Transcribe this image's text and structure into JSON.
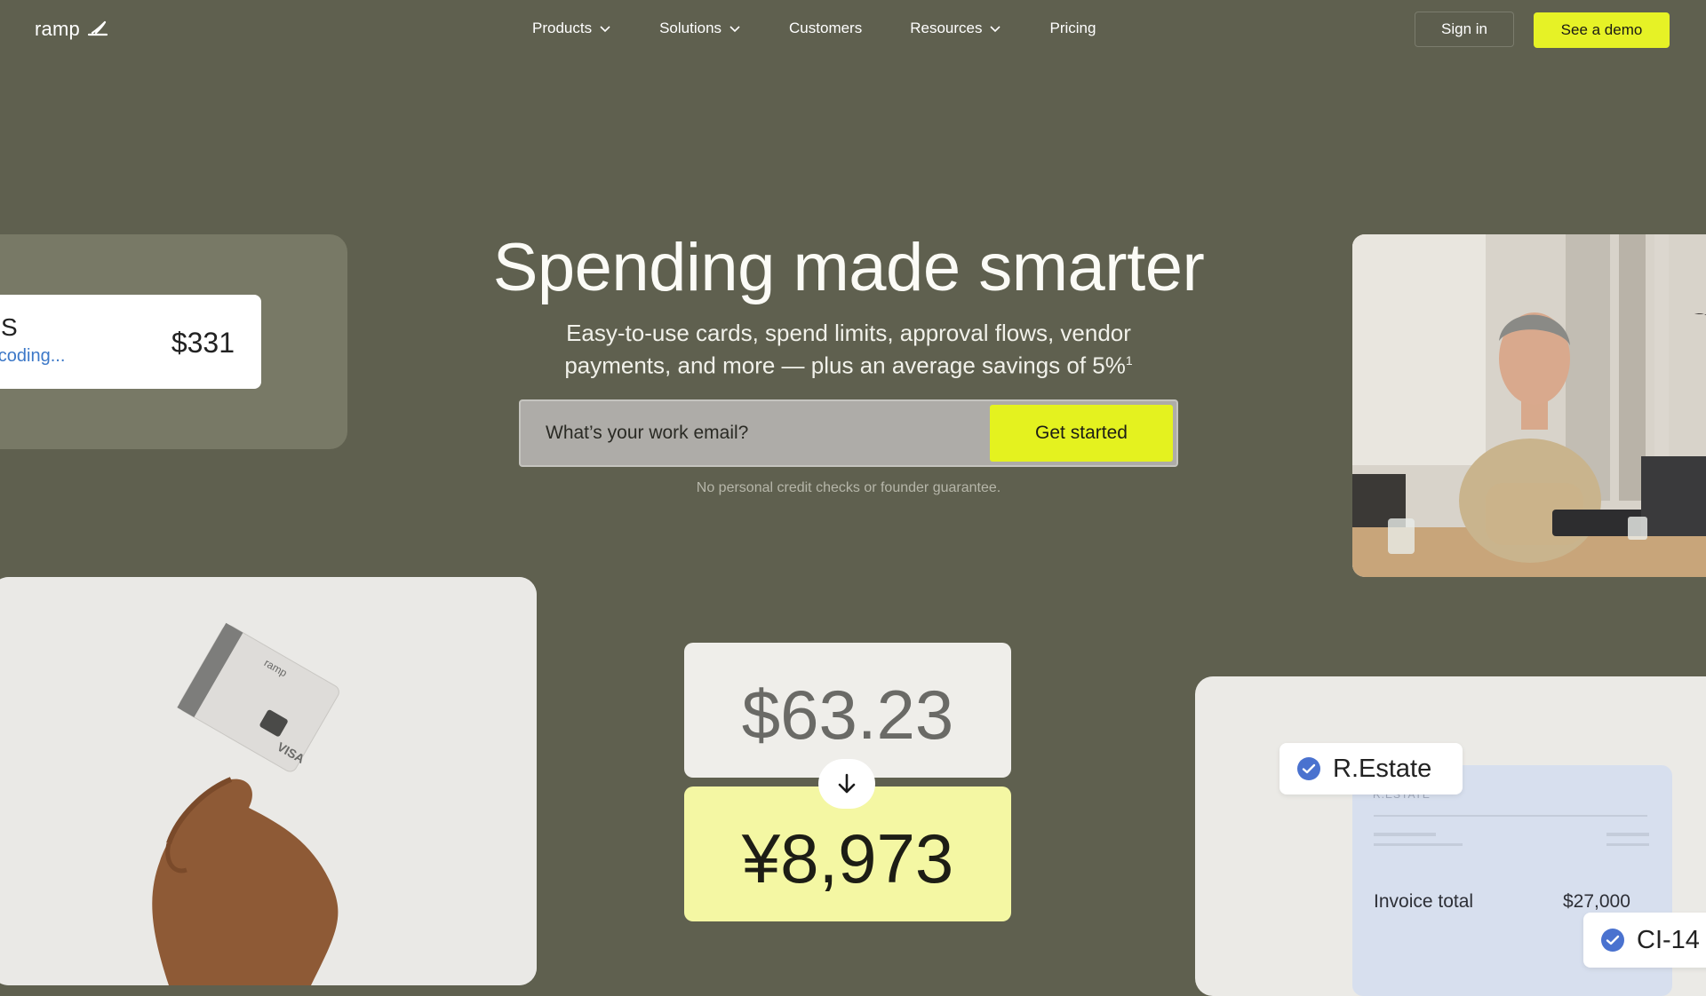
{
  "nav": {
    "logo": "ramp",
    "menu": [
      {
        "label": "Products",
        "has_dropdown": true
      },
      {
        "label": "Solutions",
        "has_dropdown": true
      },
      {
        "label": "Customers",
        "has_dropdown": false
      },
      {
        "label": "Resources",
        "has_dropdown": true
      },
      {
        "label": "Pricing",
        "has_dropdown": false
      }
    ],
    "sign_in": "Sign in",
    "demo": "See a demo"
  },
  "hero": {
    "title": "Spending made smarter",
    "subtitle_line1": "Easy-to-use cards, spend limits, approval flows, vendor",
    "subtitle_line2": "payments, and more — plus an average savings of 5%",
    "footnote_mark": "1",
    "email_placeholder": "What’s your work email?",
    "cta": "Get started",
    "note": "No personal credit checks or founder guarantee."
  },
  "transaction_card": {
    "merchant_initial": "S",
    "category": "o-coding...",
    "amount": "$331"
  },
  "conversion": {
    "from": "$63.23",
    "to": "¥8,973"
  },
  "invoice": {
    "header_faint": "R.ESTATE",
    "total_label": "Invoice total",
    "total_value": "$27,000",
    "tag1": "R.Estate",
    "tag2": "CI-14"
  },
  "colors": {
    "background": "#5f604f",
    "accent": "#e6f226",
    "accent_light": "#f4f7a3",
    "check_blue": "#4a72cf"
  }
}
